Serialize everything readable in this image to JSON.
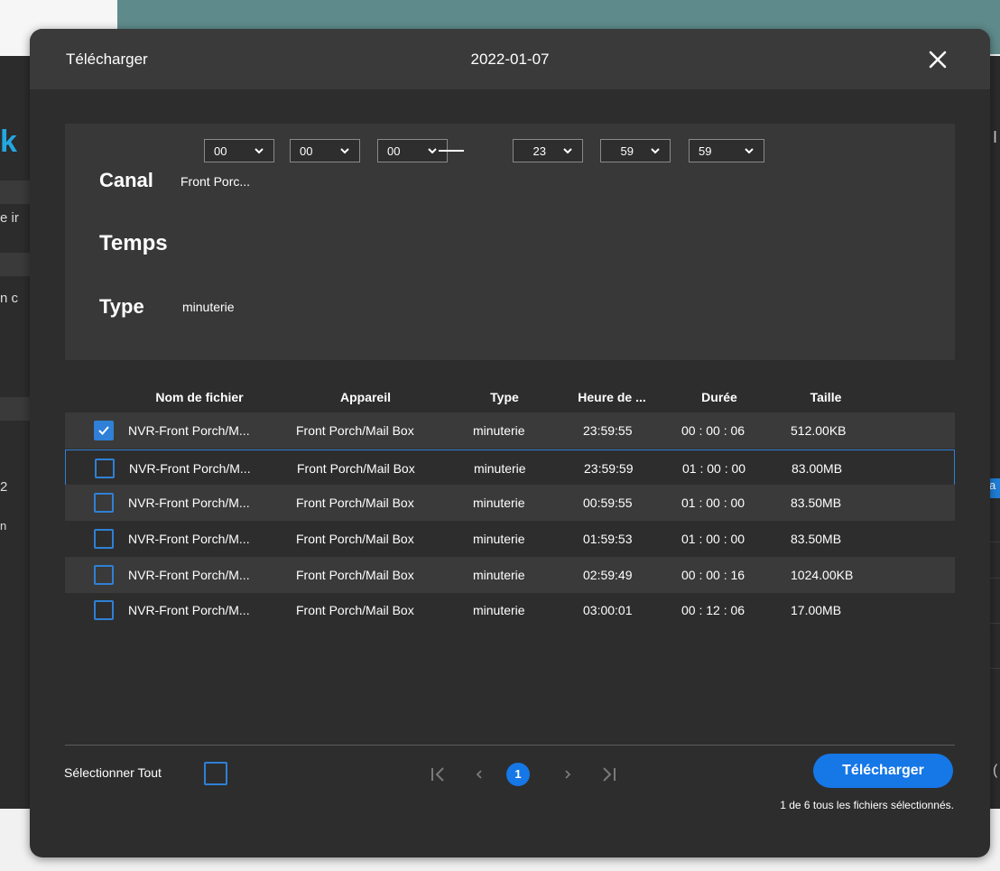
{
  "background": {
    "left_logo_fragment": "k",
    "left_texts": [
      "e ir",
      "n c",
      "2",
      "n"
    ],
    "right_badge": "a",
    "right_chars": [
      "I",
      "("
    ]
  },
  "modal": {
    "title": "Télécharger",
    "date": "2022-01-07",
    "close_icon": "close-icon"
  },
  "filters": {
    "channel_label": "Canal",
    "channel_value": "Front Porc...",
    "time_label": "Temps",
    "start_time": [
      "00",
      "00",
      "00"
    ],
    "end_time": [
      "23",
      "59",
      "59"
    ],
    "type_label": "Type",
    "type_value": "minuterie"
  },
  "table": {
    "columns": [
      "Nom de fichier",
      "Appareil",
      "Type",
      "Heure de ...",
      "Durée",
      "Taille"
    ],
    "rows": [
      {
        "checked": true,
        "name": "NVR-Front Porch/M...",
        "device": "Front Porch/Mail Box",
        "type": "minuterie",
        "time": "23:59:55",
        "duration": "00 : 00 : 06",
        "size": "512.00KB"
      },
      {
        "checked": false,
        "name": "NVR-Front Porch/M...",
        "device": "Front Porch/Mail Box",
        "type": "minuterie",
        "time": "23:59:59",
        "duration": "01 : 00 : 00",
        "size": "83.00MB"
      },
      {
        "checked": false,
        "name": "NVR-Front Porch/M...",
        "device": "Front Porch/Mail Box",
        "type": "minuterie",
        "time": "00:59:55",
        "duration": "01 : 00 : 00",
        "size": "83.50MB"
      },
      {
        "checked": false,
        "name": "NVR-Front Porch/M...",
        "device": "Front Porch/Mail Box",
        "type": "minuterie",
        "time": "01:59:53",
        "duration": "01 : 00 : 00",
        "size": "83.50MB"
      },
      {
        "checked": false,
        "name": "NVR-Front Porch/M...",
        "device": "Front Porch/Mail Box",
        "type": "minuterie",
        "time": "02:59:49",
        "duration": "00 : 00 : 16",
        "size": "1024.00KB"
      },
      {
        "checked": false,
        "name": "NVR-Front Porch/M...",
        "device": "Front Porch/Mail Box",
        "type": "minuterie",
        "time": "03:00:01",
        "duration": "00 : 12 : 06",
        "size": "17.00MB"
      }
    ]
  },
  "footer": {
    "select_all_label": "Sélectionner Tout",
    "current_page": "1",
    "download_label": "Télécharger",
    "status_text": "1 de 6 tous les fichiers sélectionnés."
  },
  "colors": {
    "accent": "#1677e6",
    "modal_bg": "#2d2d2d",
    "header_bg": "#3a3a3a",
    "panel_bg": "#383838"
  }
}
